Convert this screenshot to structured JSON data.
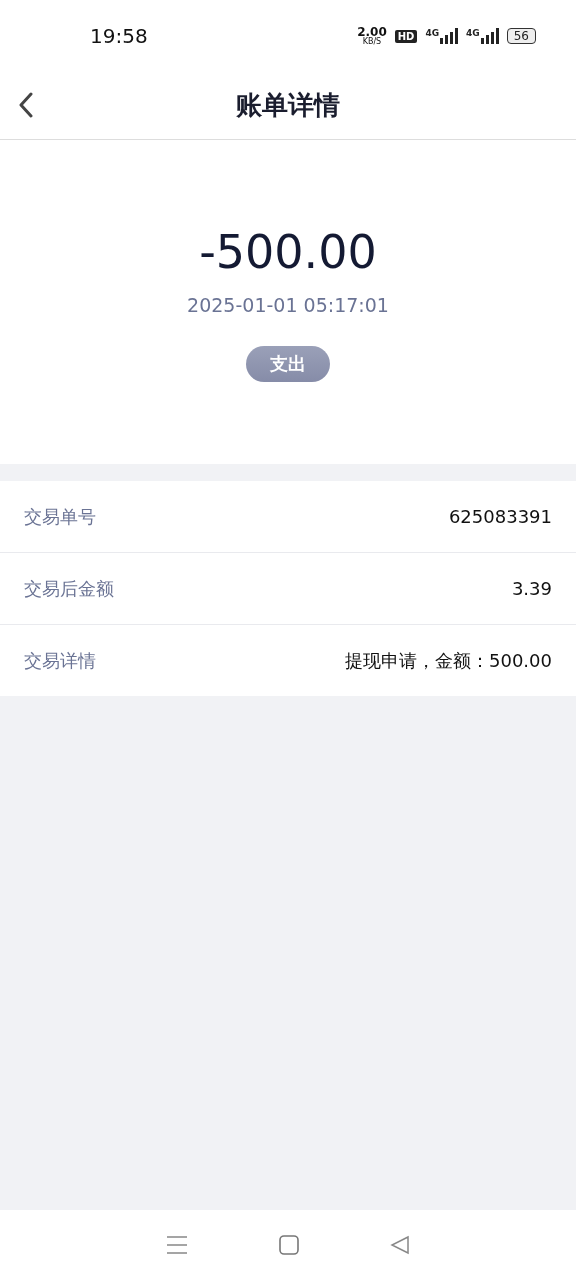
{
  "status_bar": {
    "time": "19:58",
    "speed": "2.00",
    "speed_unit": "KB/S",
    "hd": "HD",
    "signals": [
      "4G",
      "4G"
    ],
    "battery": "56"
  },
  "header": {
    "title": "账单详情"
  },
  "summary": {
    "amount": "-500.00",
    "datetime": "2025-01-01 05:17:01",
    "tag": "支出"
  },
  "details": [
    {
      "label": "交易单号",
      "value": "625083391"
    },
    {
      "label": "交易后金额",
      "value": "3.39"
    },
    {
      "label": "交易详情",
      "value": "提现申请，金额：500.00"
    }
  ]
}
